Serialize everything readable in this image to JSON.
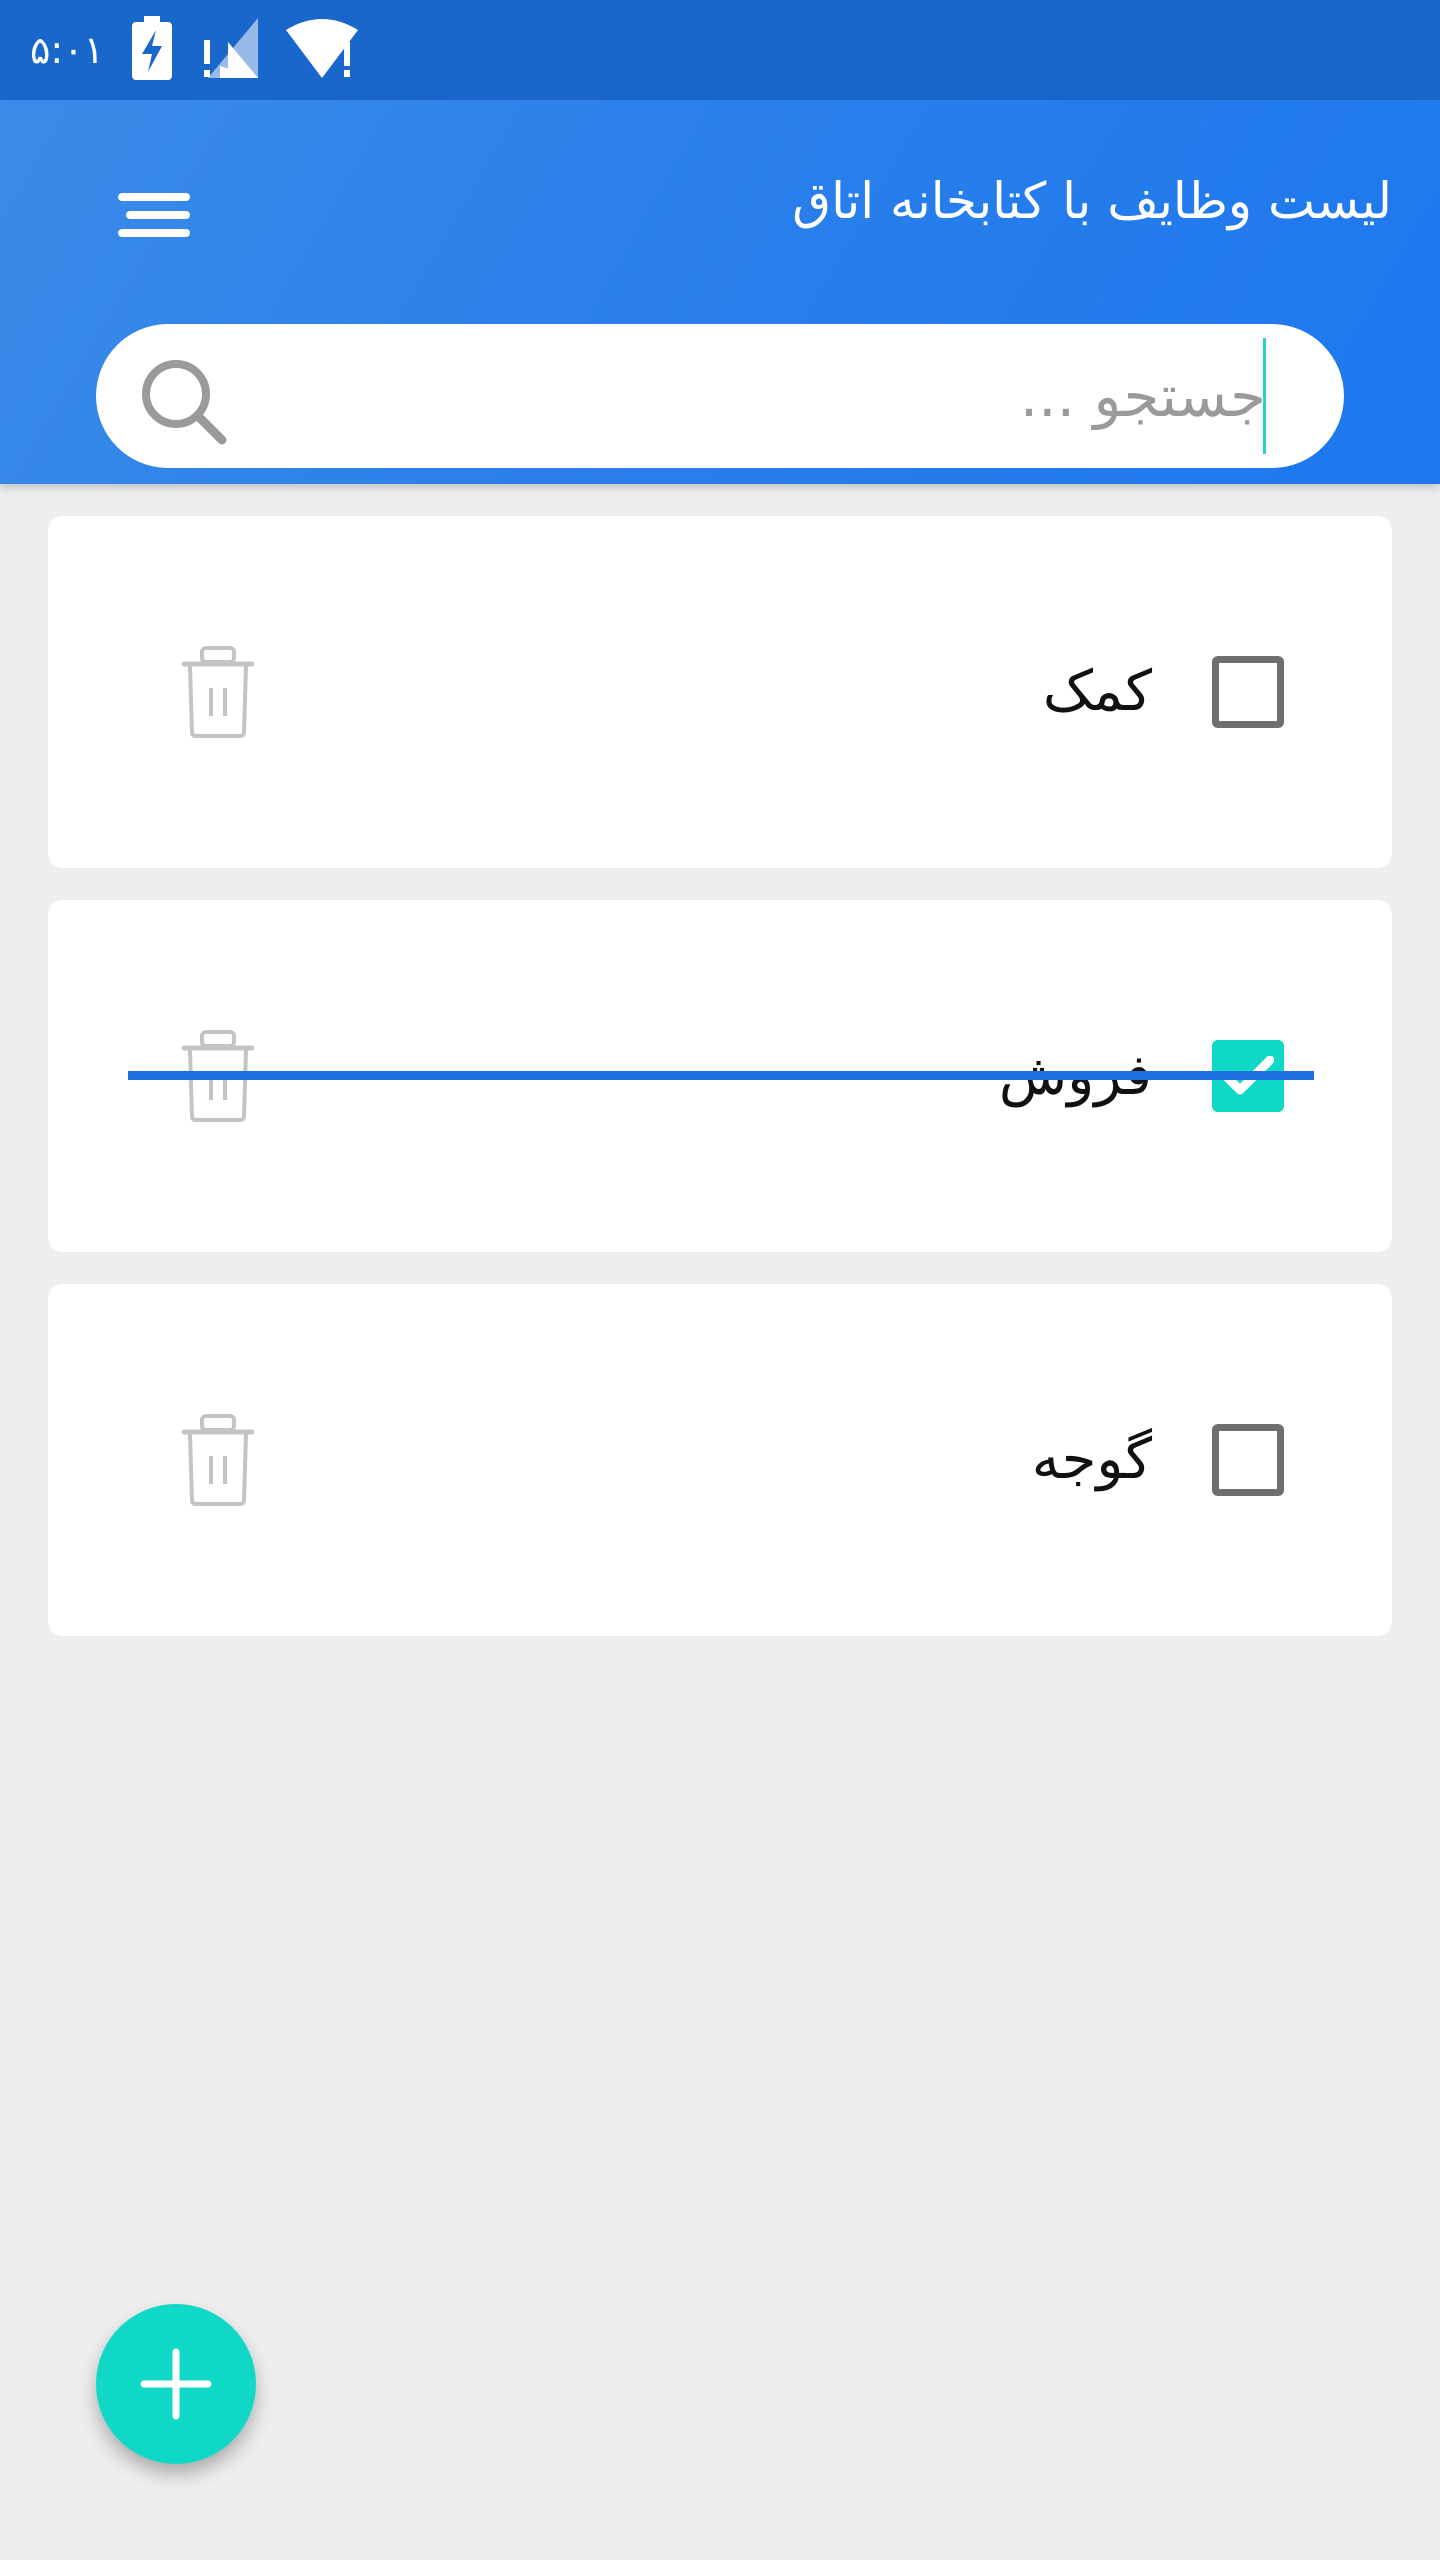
{
  "status_bar": {
    "time": "۵:۰۱",
    "icons": [
      "battery-charging-icon",
      "cell-signal-alert-icon",
      "wifi-alert-icon"
    ]
  },
  "header": {
    "title": "لیست وظایف با کتابخانه اتاق",
    "menu_icon": "menu-icon"
  },
  "search": {
    "placeholder": "جستجو ...",
    "value": "",
    "icon": "search-icon"
  },
  "tasks": [
    {
      "label": "کمک",
      "done": false
    },
    {
      "label": "فروش",
      "done": true
    },
    {
      "label": "گوجه",
      "done": false
    }
  ],
  "fab": {
    "icon": "plus-icon"
  },
  "colors": {
    "status_bar": "#1a67cc",
    "header": "#2a7fea",
    "accent": "#0fd9c6",
    "strike": "#1e6fde",
    "background": "#eeeeee"
  }
}
